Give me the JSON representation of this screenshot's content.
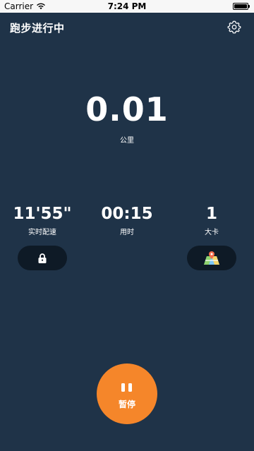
{
  "status_bar": {
    "carrier": "Carrier",
    "time": "7:24 PM"
  },
  "header": {
    "title": "跑步进行中",
    "settings_icon": "gear-icon"
  },
  "distance": {
    "value": "0.01",
    "unit": "公里"
  },
  "stats": [
    {
      "value": "11'55\"",
      "label": "实时配速"
    },
    {
      "value": "00:15",
      "label": "用时"
    },
    {
      "value": "1",
      "label": "大卡"
    }
  ],
  "controls": {
    "lock_icon": "lock-icon",
    "map_icon": "map-icon",
    "pause_label": "暂停"
  },
  "colors": {
    "background": "#1f3348",
    "pill_button": "#0e1a26",
    "accent": "#f5862a"
  }
}
